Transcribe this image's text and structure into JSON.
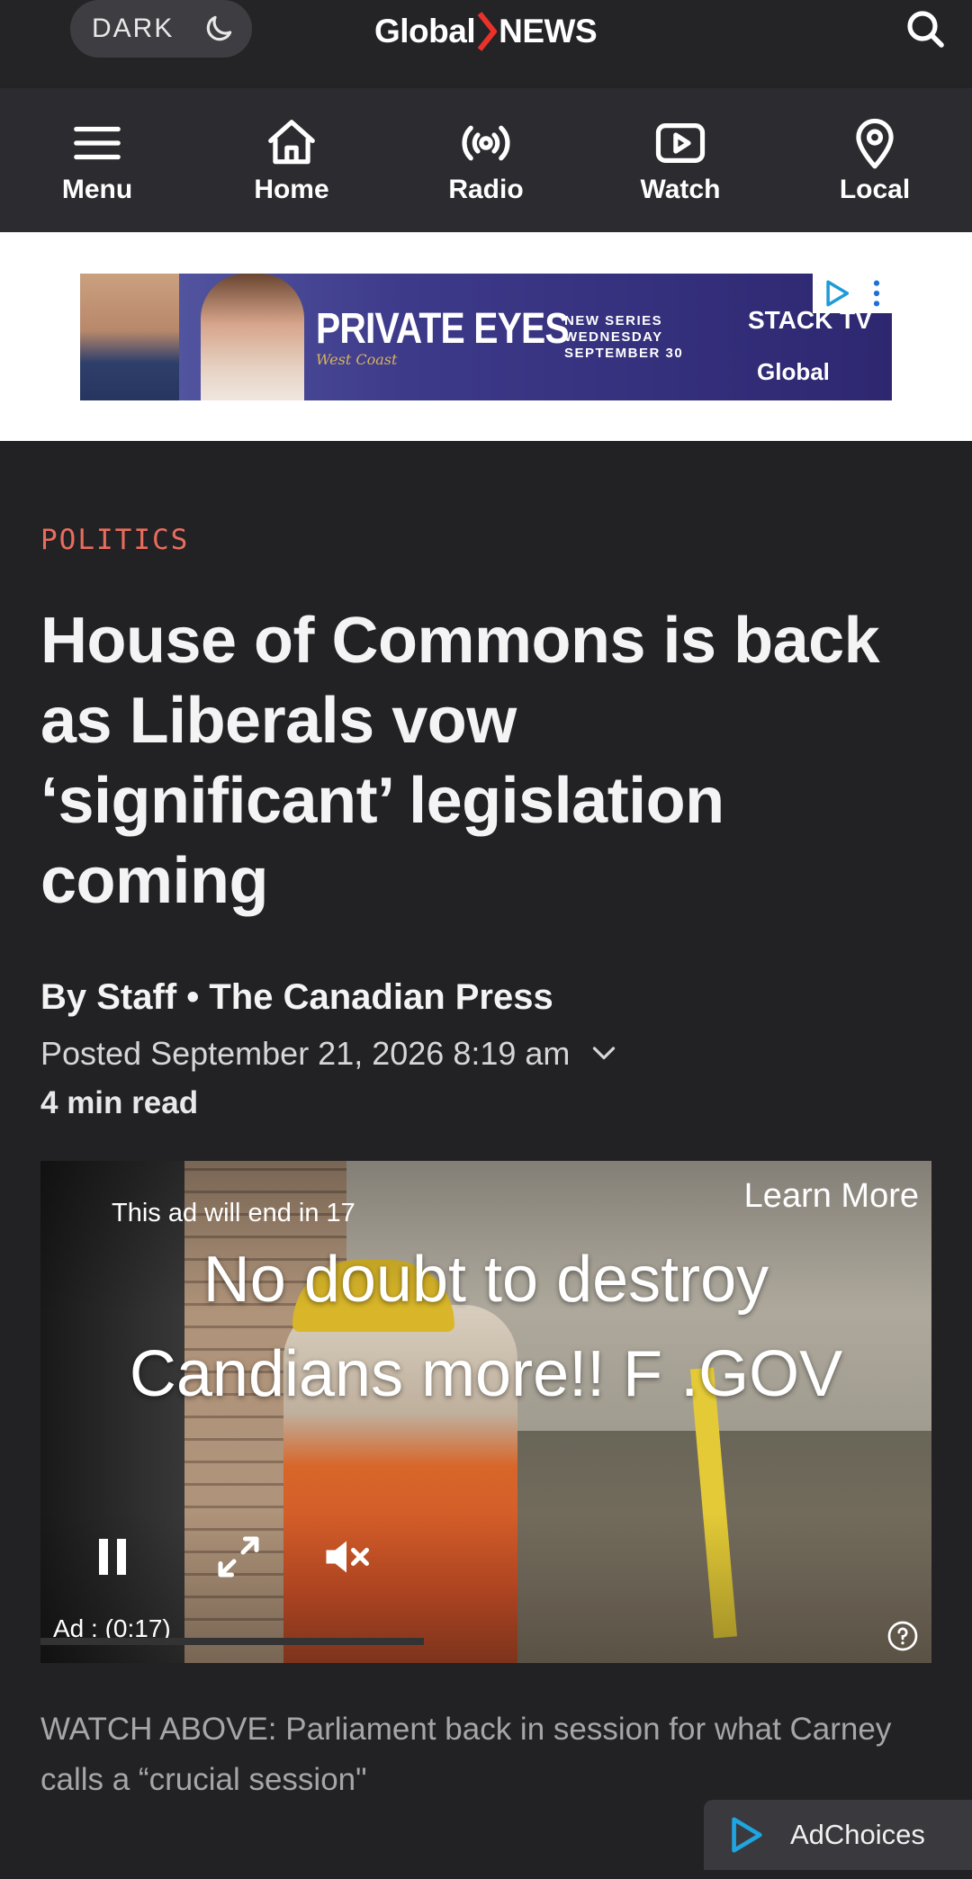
{
  "header": {
    "dark_toggle_label": "DARK",
    "logo_left": "Global",
    "logo_right": "NEWS"
  },
  "nav": {
    "items": [
      {
        "label": "Menu",
        "icon": "menu-icon"
      },
      {
        "label": "Home",
        "icon": "home-icon"
      },
      {
        "label": "Radio",
        "icon": "radio-icon"
      },
      {
        "label": "Watch",
        "icon": "play-icon"
      },
      {
        "label": "Local",
        "icon": "location-pin-icon"
      }
    ]
  },
  "banner_ad": {
    "title": "PRIVATE EYES",
    "subtitle": "West Coast",
    "series_line1": "NEW SERIES",
    "series_line2": "WEDNESDAY",
    "series_line3": "SEPTEMBER 30",
    "network1": "STACK TV",
    "network2": "Global"
  },
  "article": {
    "category": "POLITICS",
    "headline_line1": "House of Commons is back",
    "headline_line2": "as Liberals vow",
    "headline_line3": "‘significant’ legislation",
    "headline_line4": "coming",
    "byline": "By Staff • The Canadian Press",
    "posted": "Posted September 21, 2026 8:19 am",
    "read_time": "4 min read",
    "caption": "WATCH ABOVE: Parliament back in session for what Carney calls a “crucial session\""
  },
  "video": {
    "countdown": "This ad will end in 17",
    "learn_more": "Learn More",
    "overlay_line1": "No doubt to destroy",
    "overlay_line2": "Candians more!! F .GOV",
    "ad_label": "Ad : (0:17)",
    "progress_fraction": 0.43
  },
  "adchoices": {
    "label": "AdChoices"
  },
  "colors": {
    "accent_category": "#e96d5e",
    "logo_chevron": "#e8322b",
    "background": "#222124"
  }
}
